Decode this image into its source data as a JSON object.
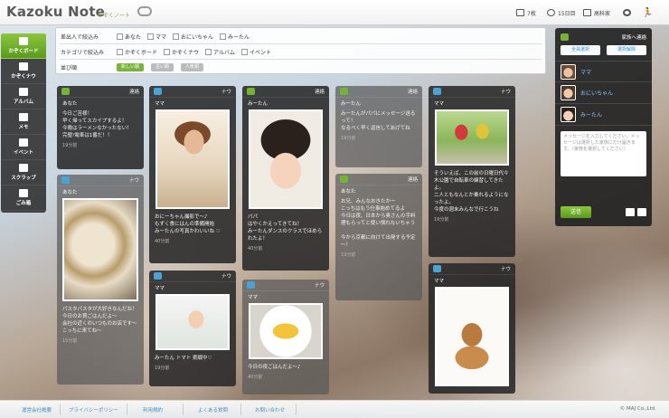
{
  "header": {
    "logo": "Kazoku Note",
    "logo_sub": "かぞくノート",
    "nav": [
      {
        "icon": "photo-icon",
        "label": "7枚"
      },
      {
        "icon": "clock-icon",
        "label": "15日目"
      },
      {
        "icon": "building-icon",
        "label": "高科家"
      },
      {
        "icon": "gear-icon",
        "label": ""
      },
      {
        "icon": "exit-icon",
        "label": ""
      }
    ]
  },
  "sidebar": {
    "items": [
      {
        "icon": "home-icon",
        "label": "かぞくボード"
      },
      {
        "icon": "family-icon",
        "label": "かぞくナウ"
      },
      {
        "icon": "album-icon",
        "label": "アルバム"
      },
      {
        "icon": "memo-icon",
        "label": "メモ"
      },
      {
        "icon": "calendar-icon",
        "label": "イベント"
      },
      {
        "icon": "scrap-icon",
        "label": "スクラップ"
      },
      {
        "icon": "trash-icon",
        "label": "ごみ箱"
      }
    ]
  },
  "filter": {
    "sender_label": "差出人で絞込み",
    "senders": [
      "あなた",
      "ママ",
      "おにいちゃん",
      "みーたん"
    ],
    "category_label": "カテゴリで絞込み",
    "categories": [
      "かぞくボード",
      "かぞくナウ",
      "アルバム",
      "イベント"
    ],
    "sort_label": "並び順",
    "sorts": [
      "新しい順",
      "古い順",
      "人気順"
    ]
  },
  "cards": {
    "c1": {
      "tag": "連絡",
      "author": "あなた",
      "body": "今日ご苦様！\n早く帰ってスカイプするよ！\n今晩はラーメンなかったない！\n完璧!電車は1番だ！！",
      "time": "19分前"
    },
    "c2": {
      "tag": "ナウ",
      "author": "あなた",
      "body": "パスタパスタが大好きなんだね！\n今日のお買ごはんだよ～\n会社の近くのいつものお店です～\nこっちに来てね～",
      "time": "15分前"
    },
    "c3": {
      "tag": "ナウ",
      "author": "ママ",
      "body": "おにーちゃん撮影で～♪\nもずく食にはんの準備開始\nみーたんの写真かわいいね ♡",
      "time": "40分前"
    },
    "c4": {
      "tag": "ナウ",
      "author": "ママ",
      "body": "みーたん トマト 挑戦中♡",
      "time": "19分前"
    },
    "c5": {
      "tag": "連絡",
      "author": "みーたん",
      "body": "パパ\nはやくかえってきてね！\nみーたんダンスのクラスでほめられたよ！",
      "time": "40分前"
    },
    "c6": {
      "tag": "ナウ",
      "author": "ママ",
      "body": "今日の夜ごはんだよ～♪",
      "time": "40分前"
    },
    "c7": {
      "tag": "連絡",
      "author": "みーたん",
      "body": "みーたんがパパにメッセージ送るって！\nなるべく早く返信してあげてね",
      "time": "19分前"
    },
    "c8": {
      "tag": "連絡",
      "author": "あなた",
      "body": "お兄、みんなおきたかー\nこっちはもう仕事始めてるよ\n今日は夜、日本から奥さんの手料理もらってと使い慣れないちゃう\n\n今から京都に向けて出発する予定～！",
      "time": "19分前"
    },
    "c9": {
      "tag": "ナウ",
      "author": "ママ",
      "body": "そういえば、この前の日曜日代々木公園で自転車の練習してきたよ。\n二人ともなんとか乗れるようになったよ。\n今度の週末みんなで行こうね",
      "time": "19分前"
    },
    "c10": {
      "tag": "ナウ",
      "author": "ママ",
      "body": "",
      "time": ""
    }
  },
  "right_panel": {
    "title": "家族へ連絡",
    "select_all": "全員選択",
    "deselect": "選択解除",
    "members": [
      "ママ",
      "おにいちゃん",
      "みーたん"
    ],
    "placeholder": "メッセージを入力してください。メッセージは選択した家族にだけ届きます。（家族を選択してください）",
    "send": "送信"
  },
  "footer": {
    "links": [
      "運営会社概要",
      "プライバシーポリシー",
      "利用規約",
      "よくある質問",
      "お問い合わせ"
    ],
    "copyright": "© MAJ Co.,Ltd."
  },
  "colors": {
    "accent": "#74b336",
    "link": "#4a8cc6",
    "card_bg": "#2b2b2b"
  }
}
